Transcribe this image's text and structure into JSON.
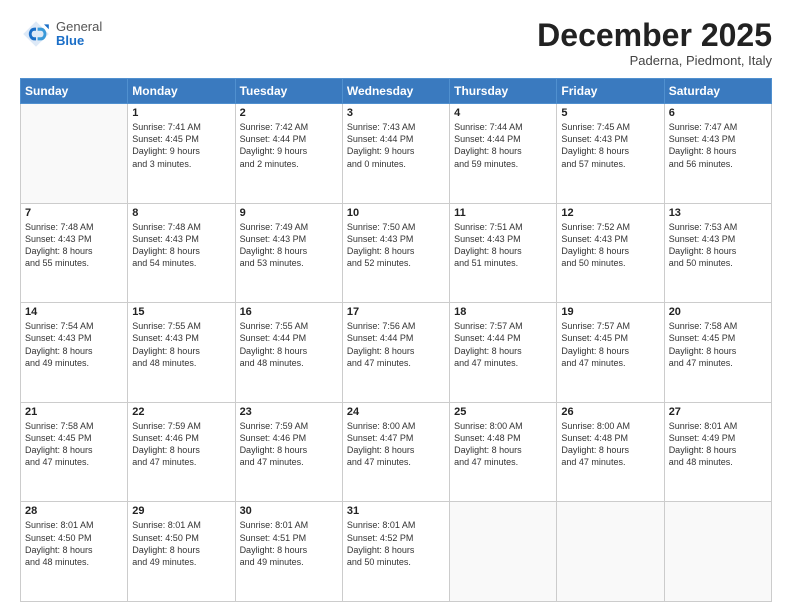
{
  "header": {
    "logo_general": "General",
    "logo_blue": "Blue",
    "month_title": "December 2025",
    "location": "Paderna, Piedmont, Italy"
  },
  "days_of_week": [
    "Sunday",
    "Monday",
    "Tuesday",
    "Wednesday",
    "Thursday",
    "Friday",
    "Saturday"
  ],
  "weeks": [
    [
      {
        "day": "",
        "info": ""
      },
      {
        "day": "1",
        "info": "Sunrise: 7:41 AM\nSunset: 4:45 PM\nDaylight: 9 hours\nand 3 minutes."
      },
      {
        "day": "2",
        "info": "Sunrise: 7:42 AM\nSunset: 4:44 PM\nDaylight: 9 hours\nand 2 minutes."
      },
      {
        "day": "3",
        "info": "Sunrise: 7:43 AM\nSunset: 4:44 PM\nDaylight: 9 hours\nand 0 minutes."
      },
      {
        "day": "4",
        "info": "Sunrise: 7:44 AM\nSunset: 4:44 PM\nDaylight: 8 hours\nand 59 minutes."
      },
      {
        "day": "5",
        "info": "Sunrise: 7:45 AM\nSunset: 4:43 PM\nDaylight: 8 hours\nand 57 minutes."
      },
      {
        "day": "6",
        "info": "Sunrise: 7:47 AM\nSunset: 4:43 PM\nDaylight: 8 hours\nand 56 minutes."
      }
    ],
    [
      {
        "day": "7",
        "info": "Sunrise: 7:48 AM\nSunset: 4:43 PM\nDaylight: 8 hours\nand 55 minutes."
      },
      {
        "day": "8",
        "info": "Sunrise: 7:48 AM\nSunset: 4:43 PM\nDaylight: 8 hours\nand 54 minutes."
      },
      {
        "day": "9",
        "info": "Sunrise: 7:49 AM\nSunset: 4:43 PM\nDaylight: 8 hours\nand 53 minutes."
      },
      {
        "day": "10",
        "info": "Sunrise: 7:50 AM\nSunset: 4:43 PM\nDaylight: 8 hours\nand 52 minutes."
      },
      {
        "day": "11",
        "info": "Sunrise: 7:51 AM\nSunset: 4:43 PM\nDaylight: 8 hours\nand 51 minutes."
      },
      {
        "day": "12",
        "info": "Sunrise: 7:52 AM\nSunset: 4:43 PM\nDaylight: 8 hours\nand 50 minutes."
      },
      {
        "day": "13",
        "info": "Sunrise: 7:53 AM\nSunset: 4:43 PM\nDaylight: 8 hours\nand 50 minutes."
      }
    ],
    [
      {
        "day": "14",
        "info": "Sunrise: 7:54 AM\nSunset: 4:43 PM\nDaylight: 8 hours\nand 49 minutes."
      },
      {
        "day": "15",
        "info": "Sunrise: 7:55 AM\nSunset: 4:43 PM\nDaylight: 8 hours\nand 48 minutes."
      },
      {
        "day": "16",
        "info": "Sunrise: 7:55 AM\nSunset: 4:44 PM\nDaylight: 8 hours\nand 48 minutes."
      },
      {
        "day": "17",
        "info": "Sunrise: 7:56 AM\nSunset: 4:44 PM\nDaylight: 8 hours\nand 47 minutes."
      },
      {
        "day": "18",
        "info": "Sunrise: 7:57 AM\nSunset: 4:44 PM\nDaylight: 8 hours\nand 47 minutes."
      },
      {
        "day": "19",
        "info": "Sunrise: 7:57 AM\nSunset: 4:45 PM\nDaylight: 8 hours\nand 47 minutes."
      },
      {
        "day": "20",
        "info": "Sunrise: 7:58 AM\nSunset: 4:45 PM\nDaylight: 8 hours\nand 47 minutes."
      }
    ],
    [
      {
        "day": "21",
        "info": "Sunrise: 7:58 AM\nSunset: 4:45 PM\nDaylight: 8 hours\nand 47 minutes."
      },
      {
        "day": "22",
        "info": "Sunrise: 7:59 AM\nSunset: 4:46 PM\nDaylight: 8 hours\nand 47 minutes."
      },
      {
        "day": "23",
        "info": "Sunrise: 7:59 AM\nSunset: 4:46 PM\nDaylight: 8 hours\nand 47 minutes."
      },
      {
        "day": "24",
        "info": "Sunrise: 8:00 AM\nSunset: 4:47 PM\nDaylight: 8 hours\nand 47 minutes."
      },
      {
        "day": "25",
        "info": "Sunrise: 8:00 AM\nSunset: 4:48 PM\nDaylight: 8 hours\nand 47 minutes."
      },
      {
        "day": "26",
        "info": "Sunrise: 8:00 AM\nSunset: 4:48 PM\nDaylight: 8 hours\nand 47 minutes."
      },
      {
        "day": "27",
        "info": "Sunrise: 8:01 AM\nSunset: 4:49 PM\nDaylight: 8 hours\nand 48 minutes."
      }
    ],
    [
      {
        "day": "28",
        "info": "Sunrise: 8:01 AM\nSunset: 4:50 PM\nDaylight: 8 hours\nand 48 minutes."
      },
      {
        "day": "29",
        "info": "Sunrise: 8:01 AM\nSunset: 4:50 PM\nDaylight: 8 hours\nand 49 minutes."
      },
      {
        "day": "30",
        "info": "Sunrise: 8:01 AM\nSunset: 4:51 PM\nDaylight: 8 hours\nand 49 minutes."
      },
      {
        "day": "31",
        "info": "Sunrise: 8:01 AM\nSunset: 4:52 PM\nDaylight: 8 hours\nand 50 minutes."
      },
      {
        "day": "",
        "info": ""
      },
      {
        "day": "",
        "info": ""
      },
      {
        "day": "",
        "info": ""
      }
    ]
  ]
}
